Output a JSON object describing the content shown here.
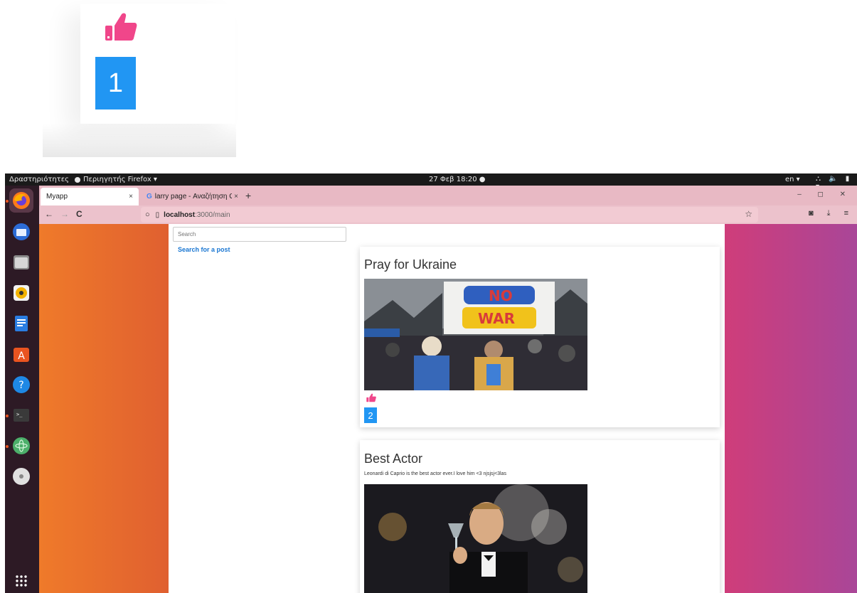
{
  "zoom": {
    "like_count": "1"
  },
  "topbar": {
    "activities": "Δραστηριότητες",
    "app_menu": "Περιηγητής Firefox ▾",
    "clock": "27 Φεβ 18:20 ●",
    "lang": "en ▾",
    "tray": "⛬ 🔈 ▮ ▾"
  },
  "dock": {
    "items": [
      "firefox-icon",
      "thunderbird-icon",
      "files-icon",
      "rhythmbox-icon",
      "writer-icon",
      "software-icon",
      "help-icon",
      "terminal-icon",
      "atom-icon",
      "disc-icon",
      "apps-grid-icon"
    ]
  },
  "browser": {
    "tabs": [
      {
        "label": "Myapp",
        "close": "×"
      },
      {
        "label": "larry page - Αναζήτηση G",
        "close": "×"
      }
    ],
    "new_tab": "+",
    "window_controls": "– ◻ ✕",
    "nav": {
      "back": "←",
      "forward": "→",
      "reload": "C"
    },
    "url": {
      "host": "localhost",
      "path": ":3000/main"
    },
    "star": "☆",
    "right_icons": "◙ ⤓ ≡"
  },
  "page": {
    "search": {
      "placeholder": "Search"
    },
    "search_link": "Search for a post",
    "posts": [
      {
        "title": "Pray for Ukraine",
        "body": "",
        "likes": "2",
        "image": "protest-photo"
      },
      {
        "title": "Best Actor",
        "body": "Leonardi di Caprio is the best actor ever.I love him <3 njsjsj<3las",
        "likes": "",
        "image": "actor-photo"
      }
    ]
  },
  "colors": {
    "like_pink": "#f0468a",
    "badge_blue": "#2196f3",
    "tabbar": "#e8b9c4",
    "link_blue": "#1976d2"
  }
}
